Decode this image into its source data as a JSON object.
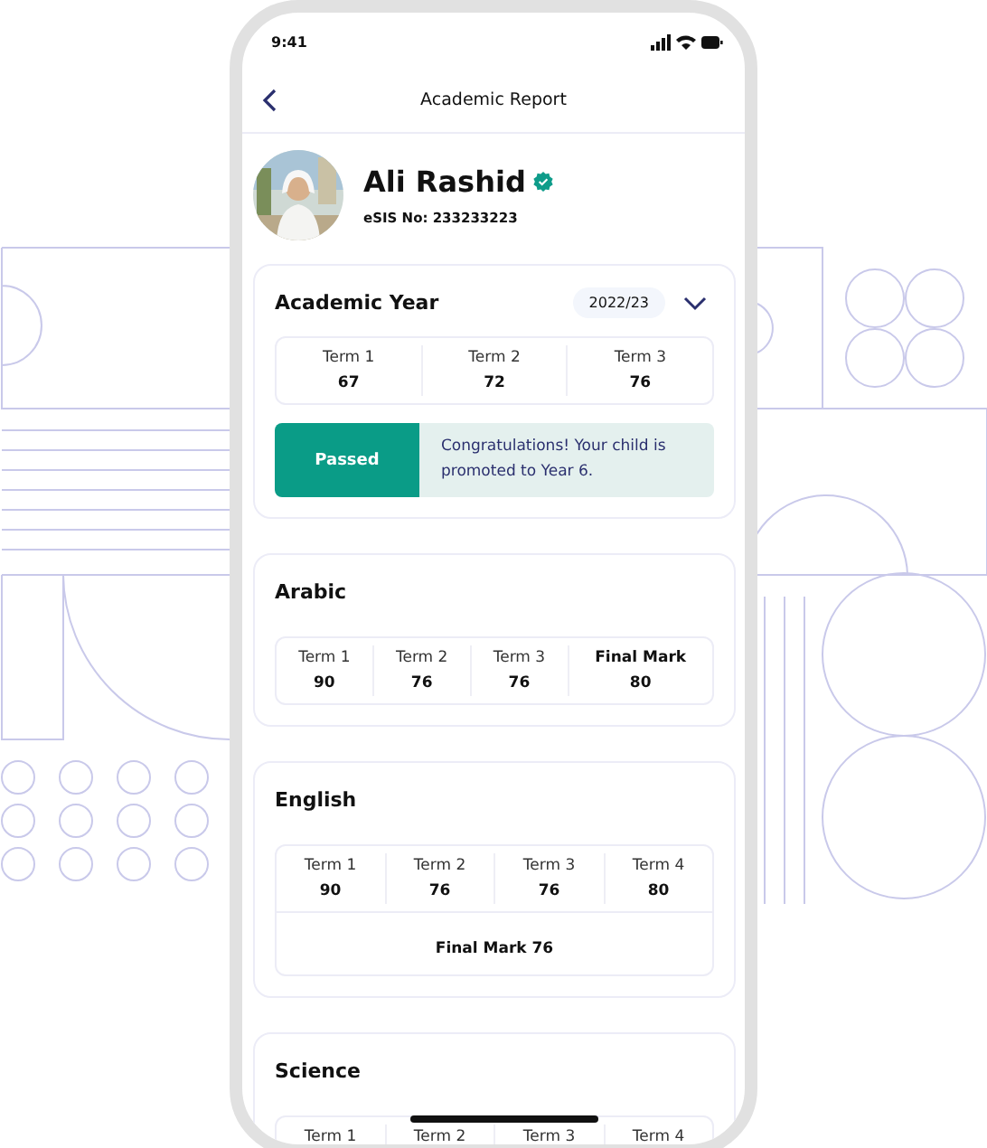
{
  "status_bar": {
    "time": "9:41"
  },
  "header": {
    "title": "Academic Report"
  },
  "profile": {
    "name": "Ali Rashid",
    "verified": true,
    "id_line": "eSIS No: 233233223"
  },
  "academic_year": {
    "title": "Academic Year",
    "year": "2022/23",
    "expanded": false,
    "terms": [
      {
        "label": "Term 1",
        "value": "67"
      },
      {
        "label": "Term 2",
        "value": "72"
      },
      {
        "label": "Term 3",
        "value": "76"
      }
    ],
    "result": {
      "status": "Passed",
      "message": "Congratulations! Your child is promoted to Year 6."
    }
  },
  "subjects": [
    {
      "name": "Arabic",
      "cells": [
        {
          "label": "Term 1",
          "value": "90",
          "emphasis": false
        },
        {
          "label": "Term 2",
          "value": "76",
          "emphasis": false
        },
        {
          "label": "Term 3",
          "value": "76",
          "emphasis": false
        },
        {
          "label": "Final Mark",
          "value": "80",
          "emphasis": true
        }
      ]
    },
    {
      "name": "English",
      "cells": [
        {
          "label": "Term 1",
          "value": "90",
          "emphasis": false
        },
        {
          "label": "Term 2",
          "value": "76",
          "emphasis": false
        },
        {
          "label": "Term 3",
          "value": "76",
          "emphasis": false
        },
        {
          "label": "Term 4",
          "value": "80",
          "emphasis": false
        }
      ],
      "final_mark": "Final Mark 76"
    },
    {
      "name": "Science",
      "cells": [
        {
          "label": "Term 1",
          "emphasis": false
        },
        {
          "label": "Term 2",
          "emphasis": false
        },
        {
          "label": "Term 3",
          "emphasis": false
        },
        {
          "label": "Term 4",
          "emphasis": false
        }
      ]
    }
  ]
}
